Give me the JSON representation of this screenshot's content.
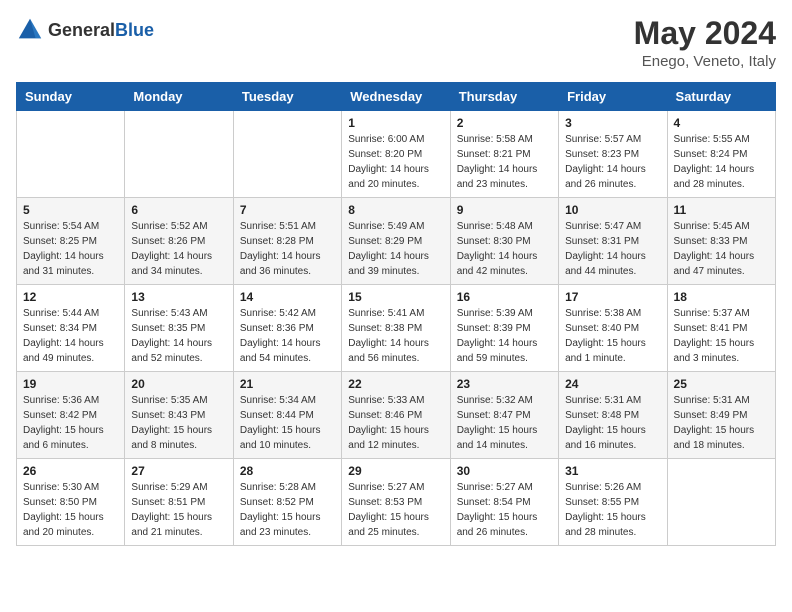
{
  "header": {
    "logo_general": "General",
    "logo_blue": "Blue",
    "month_year": "May 2024",
    "location": "Enego, Veneto, Italy"
  },
  "days_of_week": [
    "Sunday",
    "Monday",
    "Tuesday",
    "Wednesday",
    "Thursday",
    "Friday",
    "Saturday"
  ],
  "weeks": [
    [
      {
        "day": "",
        "info": ""
      },
      {
        "day": "",
        "info": ""
      },
      {
        "day": "",
        "info": ""
      },
      {
        "day": "1",
        "info": "Sunrise: 6:00 AM\nSunset: 8:20 PM\nDaylight: 14 hours\nand 20 minutes."
      },
      {
        "day": "2",
        "info": "Sunrise: 5:58 AM\nSunset: 8:21 PM\nDaylight: 14 hours\nand 23 minutes."
      },
      {
        "day": "3",
        "info": "Sunrise: 5:57 AM\nSunset: 8:23 PM\nDaylight: 14 hours\nand 26 minutes."
      },
      {
        "day": "4",
        "info": "Sunrise: 5:55 AM\nSunset: 8:24 PM\nDaylight: 14 hours\nand 28 minutes."
      }
    ],
    [
      {
        "day": "5",
        "info": "Sunrise: 5:54 AM\nSunset: 8:25 PM\nDaylight: 14 hours\nand 31 minutes."
      },
      {
        "day": "6",
        "info": "Sunrise: 5:52 AM\nSunset: 8:26 PM\nDaylight: 14 hours\nand 34 minutes."
      },
      {
        "day": "7",
        "info": "Sunrise: 5:51 AM\nSunset: 8:28 PM\nDaylight: 14 hours\nand 36 minutes."
      },
      {
        "day": "8",
        "info": "Sunrise: 5:49 AM\nSunset: 8:29 PM\nDaylight: 14 hours\nand 39 minutes."
      },
      {
        "day": "9",
        "info": "Sunrise: 5:48 AM\nSunset: 8:30 PM\nDaylight: 14 hours\nand 42 minutes."
      },
      {
        "day": "10",
        "info": "Sunrise: 5:47 AM\nSunset: 8:31 PM\nDaylight: 14 hours\nand 44 minutes."
      },
      {
        "day": "11",
        "info": "Sunrise: 5:45 AM\nSunset: 8:33 PM\nDaylight: 14 hours\nand 47 minutes."
      }
    ],
    [
      {
        "day": "12",
        "info": "Sunrise: 5:44 AM\nSunset: 8:34 PM\nDaylight: 14 hours\nand 49 minutes."
      },
      {
        "day": "13",
        "info": "Sunrise: 5:43 AM\nSunset: 8:35 PM\nDaylight: 14 hours\nand 52 minutes."
      },
      {
        "day": "14",
        "info": "Sunrise: 5:42 AM\nSunset: 8:36 PM\nDaylight: 14 hours\nand 54 minutes."
      },
      {
        "day": "15",
        "info": "Sunrise: 5:41 AM\nSunset: 8:38 PM\nDaylight: 14 hours\nand 56 minutes."
      },
      {
        "day": "16",
        "info": "Sunrise: 5:39 AM\nSunset: 8:39 PM\nDaylight: 14 hours\nand 59 minutes."
      },
      {
        "day": "17",
        "info": "Sunrise: 5:38 AM\nSunset: 8:40 PM\nDaylight: 15 hours\nand 1 minute."
      },
      {
        "day": "18",
        "info": "Sunrise: 5:37 AM\nSunset: 8:41 PM\nDaylight: 15 hours\nand 3 minutes."
      }
    ],
    [
      {
        "day": "19",
        "info": "Sunrise: 5:36 AM\nSunset: 8:42 PM\nDaylight: 15 hours\nand 6 minutes."
      },
      {
        "day": "20",
        "info": "Sunrise: 5:35 AM\nSunset: 8:43 PM\nDaylight: 15 hours\nand 8 minutes."
      },
      {
        "day": "21",
        "info": "Sunrise: 5:34 AM\nSunset: 8:44 PM\nDaylight: 15 hours\nand 10 minutes."
      },
      {
        "day": "22",
        "info": "Sunrise: 5:33 AM\nSunset: 8:46 PM\nDaylight: 15 hours\nand 12 minutes."
      },
      {
        "day": "23",
        "info": "Sunrise: 5:32 AM\nSunset: 8:47 PM\nDaylight: 15 hours\nand 14 minutes."
      },
      {
        "day": "24",
        "info": "Sunrise: 5:31 AM\nSunset: 8:48 PM\nDaylight: 15 hours\nand 16 minutes."
      },
      {
        "day": "25",
        "info": "Sunrise: 5:31 AM\nSunset: 8:49 PM\nDaylight: 15 hours\nand 18 minutes."
      }
    ],
    [
      {
        "day": "26",
        "info": "Sunrise: 5:30 AM\nSunset: 8:50 PM\nDaylight: 15 hours\nand 20 minutes."
      },
      {
        "day": "27",
        "info": "Sunrise: 5:29 AM\nSunset: 8:51 PM\nDaylight: 15 hours\nand 21 minutes."
      },
      {
        "day": "28",
        "info": "Sunrise: 5:28 AM\nSunset: 8:52 PM\nDaylight: 15 hours\nand 23 minutes."
      },
      {
        "day": "29",
        "info": "Sunrise: 5:27 AM\nSunset: 8:53 PM\nDaylight: 15 hours\nand 25 minutes."
      },
      {
        "day": "30",
        "info": "Sunrise: 5:27 AM\nSunset: 8:54 PM\nDaylight: 15 hours\nand 26 minutes."
      },
      {
        "day": "31",
        "info": "Sunrise: 5:26 AM\nSunset: 8:55 PM\nDaylight: 15 hours\nand 28 minutes."
      },
      {
        "day": "",
        "info": ""
      }
    ]
  ]
}
